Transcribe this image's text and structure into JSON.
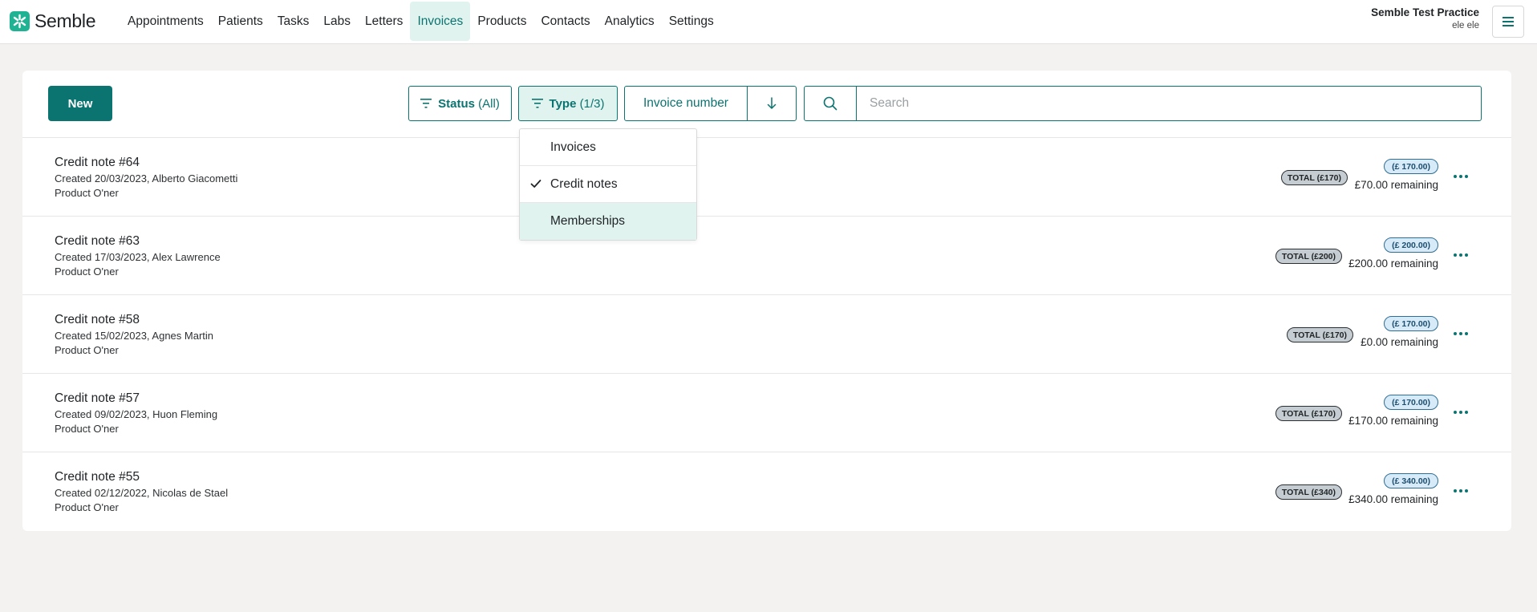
{
  "brand": {
    "name": "Semble",
    "logo_color": "#1fb394"
  },
  "nav": {
    "items": [
      {
        "label": "Appointments"
      },
      {
        "label": "Patients"
      },
      {
        "label": "Tasks"
      },
      {
        "label": "Labs"
      },
      {
        "label": "Letters"
      },
      {
        "label": "Invoices",
        "active": true
      },
      {
        "label": "Products"
      },
      {
        "label": "Contacts"
      },
      {
        "label": "Analytics"
      },
      {
        "label": "Settings"
      }
    ]
  },
  "practice": {
    "name": "Semble Test Practice",
    "user": "ele ele"
  },
  "toolbar": {
    "new_label": "New",
    "status_filter": {
      "label": "Status",
      "value": "(All)"
    },
    "type_filter": {
      "label": "Type",
      "value": "(1/3)"
    },
    "sort_label": "Invoice number",
    "search_placeholder": "Search"
  },
  "type_dropdown": {
    "options": [
      {
        "label": "Invoices",
        "checked": false
      },
      {
        "label": "Credit notes",
        "checked": true
      },
      {
        "label": "Memberships",
        "checked": false,
        "highlighted": true
      }
    ]
  },
  "rows": [
    {
      "title": "Credit note #64",
      "created": "Created 20/03/2023, Alberto Giacometti",
      "product": "Product O'ner",
      "total": "TOTAL (£170)",
      "amount": "(£ 170.00)",
      "remaining": "£70.00 remaining"
    },
    {
      "title": "Credit note #63",
      "created": "Created 17/03/2023, Alex Lawrence",
      "product": "Product O'ner",
      "total": "TOTAL (£200)",
      "amount": "(£ 200.00)",
      "remaining": "£200.00 remaining"
    },
    {
      "title": "Credit note #58",
      "created": "Created 15/02/2023, Agnes Martin",
      "product": "Product O'ner",
      "total": "TOTAL (£170)",
      "amount": "(£ 170.00)",
      "remaining": "£0.00 remaining"
    },
    {
      "title": "Credit note #57",
      "created": "Created 09/02/2023, Huon Fleming",
      "product": "Product O'ner",
      "total": "TOTAL (£170)",
      "amount": "(£ 170.00)",
      "remaining": "£170.00 remaining"
    },
    {
      "title": "Credit note #55",
      "created": "Created 02/12/2022, Nicolas de Stael",
      "product": "Product O'ner",
      "total": "TOTAL (£340)",
      "amount": "(£ 340.00)",
      "remaining": "£340.00 remaining"
    }
  ],
  "colors": {
    "accent": "#0b7470",
    "accent_light": "#e0f3ef",
    "background": "#f3f2f0"
  }
}
